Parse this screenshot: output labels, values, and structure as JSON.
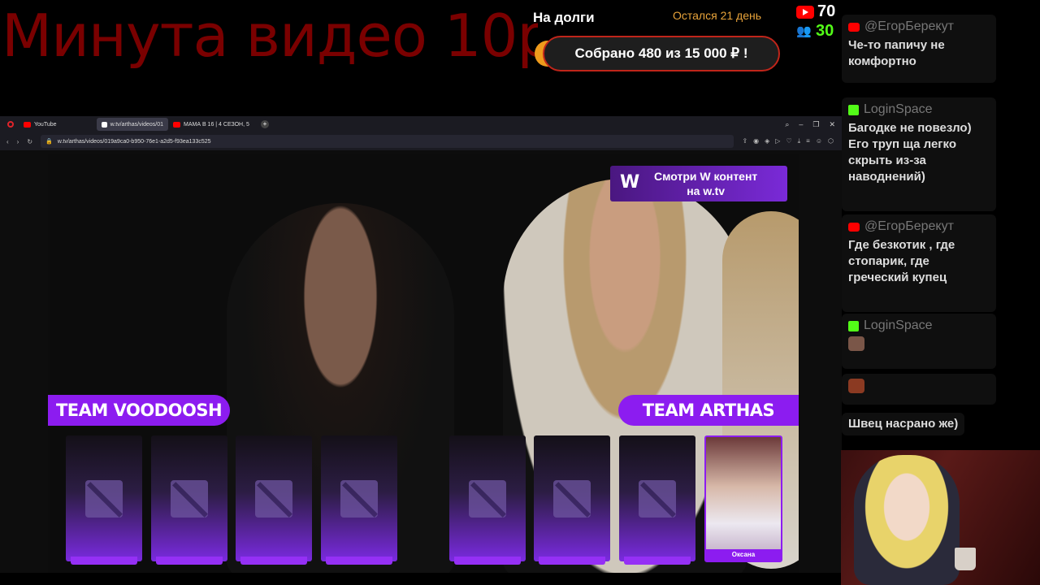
{
  "overlay": {
    "big_title": "Минута видео 10р",
    "debt_label": "На долги",
    "days_left": "Остался 21 день",
    "collected": "Собрано 480  из 15 000 ₽ !",
    "youtube_viewers": "70",
    "kick_viewers": "30",
    "accent_colors": {
      "title": "#7a0000",
      "progress": "#ef9b1c",
      "kick": "#53fc18",
      "youtube": "#ff0000"
    }
  },
  "browser": {
    "tabs": [
      {
        "label": "YouTube",
        "icon": "youtube-icon"
      },
      {
        "label": "w.tv/arthas/videos/01",
        "icon": "w-icon",
        "active": true
      },
      {
        "label": "МАМА В 16 | 4 СЕЗОН, 5",
        "icon": "youtube-icon"
      }
    ],
    "url": "w.tv/arthas/videos/019a9ca0-b950-76e1-a2d5-f93ea133c525"
  },
  "video": {
    "promo_line1": "Смотри W контент",
    "promo_line2": "на w.tv",
    "logo": "W",
    "team_left": "TEAM VOODOOSH",
    "team_right": "TEAM ARTHAS",
    "player_name": "Оксана",
    "accent": "#8c1cf0"
  },
  "chat": {
    "messages": [
      {
        "platform": "youtube",
        "author": "@ЕгорБерекут",
        "text": "Че-то папичу не комфортно"
      },
      {
        "platform": "kick",
        "author": "LoginSpace",
        "text": "Багодке не повезло) Его труп ща легко скрыть из-за наводнений)"
      },
      {
        "platform": "youtube",
        "author": "@ЕгорБерекут",
        "text": "Где безкотик , где стопарик, где греческий купец"
      },
      {
        "platform": "kick",
        "author": "LoginSpace",
        "text": ""
      },
      {
        "text": "Швец насрано же)"
      }
    ]
  }
}
